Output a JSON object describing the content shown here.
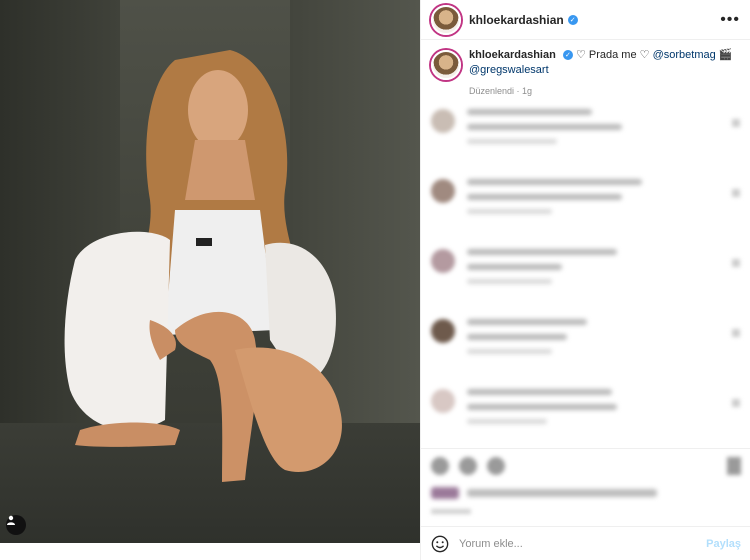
{
  "post": {
    "author": "khloekardashian",
    "caption_prefix": "Prada me",
    "mention_1": "@sorbetmag",
    "mention_2": "@gregswalesart",
    "edited_label": "Düzenlendi",
    "time_ago": "1g"
  },
  "comment_box": {
    "placeholder": "Yorum ekle...",
    "share_label": "Paylaş"
  },
  "comments": [
    {
      "avatar_color": "#c9bdb4"
    },
    {
      "avatar_color": "#a08a80"
    },
    {
      "avatar_color": "#b49aa0"
    },
    {
      "avatar_color": "#6e5a4c"
    },
    {
      "avatar_color": "#d8c8c4"
    }
  ],
  "colors": {
    "link": "#00376b",
    "verified": "#3897f0",
    "story_ring": "#c13584"
  }
}
